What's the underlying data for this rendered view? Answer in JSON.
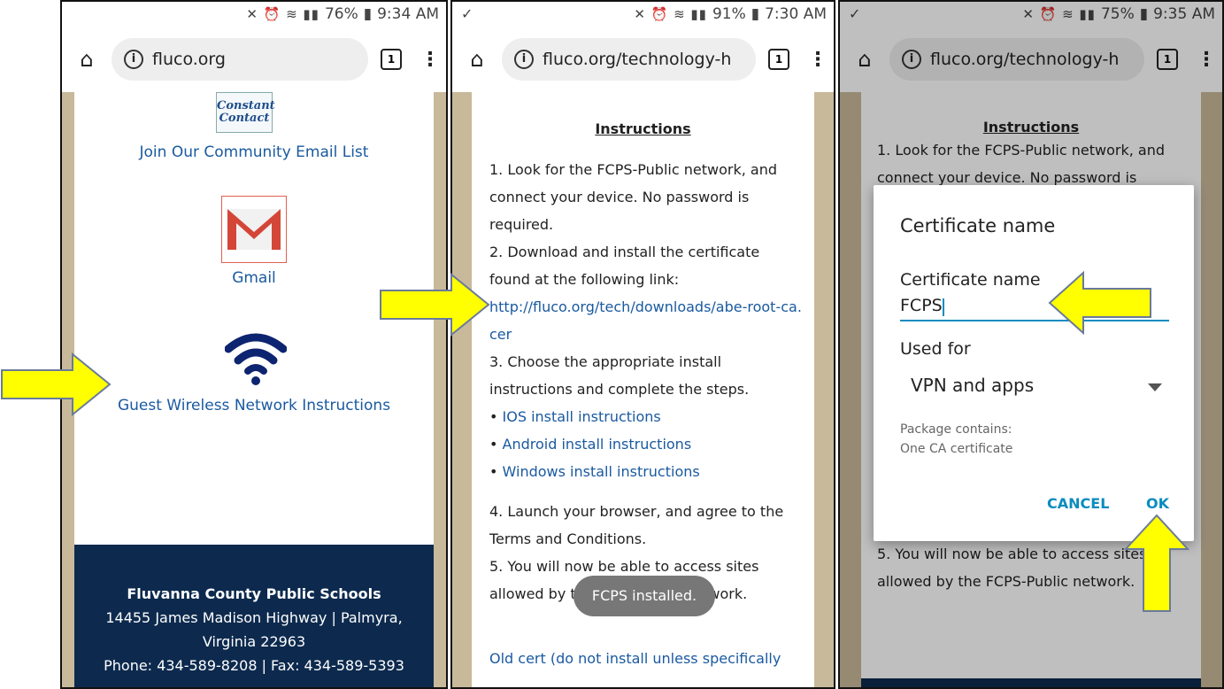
{
  "panel1": {
    "status": {
      "battery": "76%",
      "time": "9:34 AM"
    },
    "url": "fluco.org",
    "tabs_count": "1",
    "cc_logo_line1": "Constant",
    "cc_logo_line2": "Contact",
    "email_list_link": "Join Our Community Email List",
    "gmail_label": "Gmail",
    "wifi_link": "Guest Wireless Network Instructions",
    "footer": {
      "name": "Fluvanna County Public Schools",
      "address1": "14455 James Madison Highway | Palmyra,",
      "address2": "Virginia 22963",
      "phone": "Phone: 434-589-8208 | Fax: 434-589-5393"
    }
  },
  "panel2": {
    "status": {
      "battery": "91%",
      "time": "7:30 AM"
    },
    "url": "fluco.org/technology-h",
    "tabs_count": "1",
    "heading": "Instructions",
    "step1": "1. Look for the FCPS-Public network, and connect your device. No password is required.",
    "step2": "2. Download and install the certificate found at the following link:",
    "cert_link": "http://fluco.org/tech/downloads/abe-root-ca.cer",
    "step3": "3. Choose the appropriate install instructions and complete the steps.",
    "bullets": [
      "IOS install instructions",
      "Android install instructions",
      "Windows install instructions"
    ],
    "step4": "4. Launch your browser, and agree to the Terms and Conditions.",
    "step5": "5. You will now be able to access sites allowed by the FCPS-Public network.",
    "toast": "FCPS installed.",
    "old_cert": "Old cert (do not install unless specifically"
  },
  "panel3": {
    "status": {
      "battery": "75%",
      "time": "9:35 AM"
    },
    "url": "fluco.org/technology-h",
    "tabs_count": "1",
    "heading": "Instructions",
    "step1": "1. Look for the FCPS-Public network, and connect your device. No password is",
    "step5": "5. You will now be able to access sites allowed by the FCPS-Public network.",
    "dialog": {
      "title": "Certificate name",
      "field_label": "Certificate name",
      "field_value": "FCPS",
      "used_for_label": "Used for",
      "used_for_value": "VPN and apps",
      "package_line1": "Package contains:",
      "package_line2": "One CA certificate",
      "cancel": "CANCEL",
      "ok": "OK"
    }
  },
  "colors": {
    "arrow": "#ffff00",
    "link": "#1a5aa0",
    "footer": "#0d2a4e",
    "accent": "#0a8cc0"
  }
}
